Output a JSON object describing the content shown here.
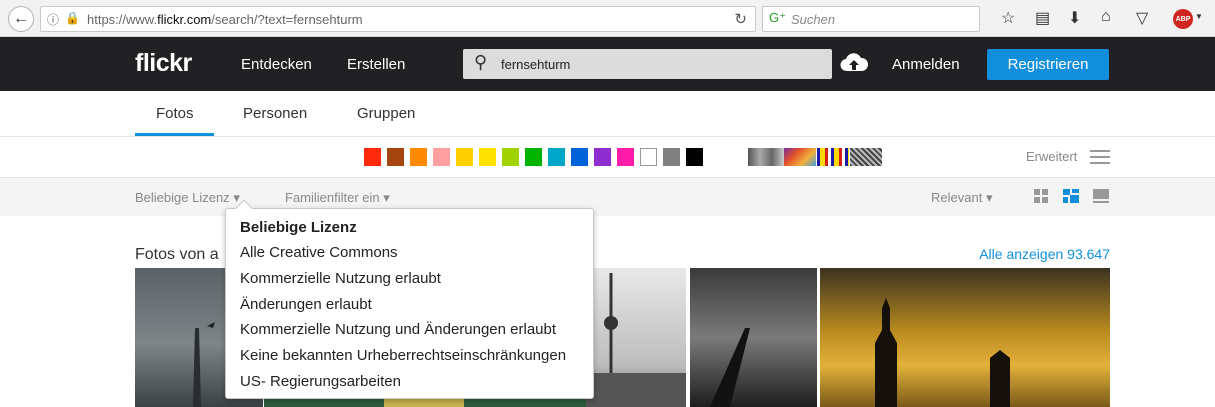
{
  "browser": {
    "url_prefix": "https://www.",
    "url_domain": "flickr.com",
    "url_path": "/search/?text=fernsehturm",
    "search_placeholder": "Suchen"
  },
  "header": {
    "logo": "flickr",
    "nav": [
      "Entdecken",
      "Erstellen"
    ],
    "search_value": "fernsehturm",
    "login": "Anmelden",
    "register": "Registrieren"
  },
  "tabs": [
    "Fotos",
    "Personen",
    "Gruppen"
  ],
  "colors": [
    "#ff2a0e",
    "#a5450f",
    "#ff8a00",
    "#ffa0a0",
    "#ffcf00",
    "#ffe100",
    "#a0d300",
    "#00b300",
    "#00a6c8",
    "#0062d8",
    "#8e2ed0",
    "#ff1ca8",
    "#ffffff",
    "#808080",
    "#000000"
  ],
  "advanced_label": "Erweitert",
  "filters": {
    "license": "Beliebige Lizenz",
    "family": "Familienfilter ein",
    "sort": "Relevant"
  },
  "section": {
    "title": "Fotos von a",
    "show_all": "Alle anzeigen 93.647"
  },
  "license_menu": [
    "Beliebige Lizenz",
    "Alle Creative Commons",
    "Kommerzielle Nutzung erlaubt",
    "Änderungen erlaubt",
    "Kommerzielle Nutzung und Änderungen erlaubt",
    "Keine bekannten Urheberrechtseinschränkungen",
    "US- Regierungsarbeiten"
  ]
}
